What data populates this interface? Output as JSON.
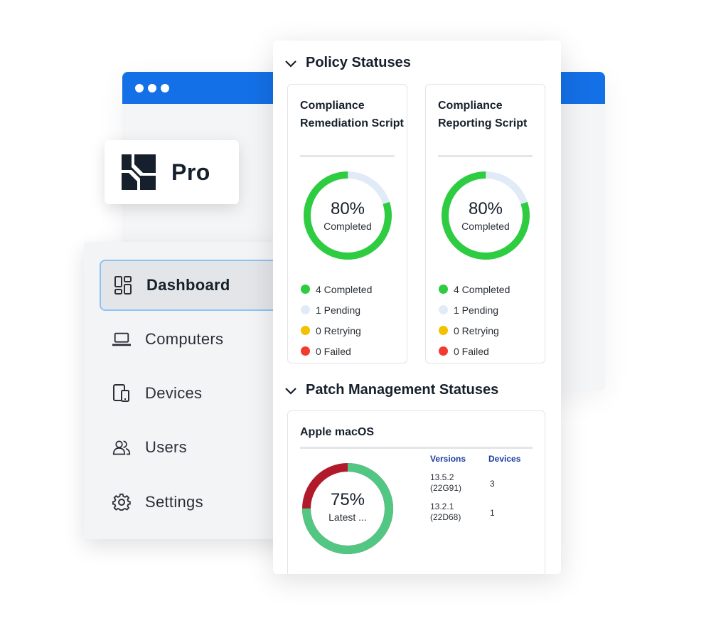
{
  "brand": {
    "name": "Pro"
  },
  "sidebar": {
    "items": [
      {
        "label": "Dashboard",
        "icon": "dashboard-grid-icon",
        "active": true
      },
      {
        "label": "Computers",
        "icon": "laptop-icon",
        "active": false
      },
      {
        "label": "Devices",
        "icon": "devices-icon",
        "active": false
      },
      {
        "label": "Users",
        "icon": "users-icon",
        "active": false
      },
      {
        "label": "Settings",
        "icon": "gear-icon",
        "active": false
      }
    ]
  },
  "policy": {
    "section_title": "Policy Statuses",
    "cards": [
      {
        "title": "Compliance Remediation Script",
        "percent": "80%",
        "percent_label": "Completed",
        "completed_fraction": 0.8,
        "legend": [
          {
            "label": "4 Completed",
            "color": "#2ecc40"
          },
          {
            "label": "1 Pending",
            "color": "#e1ebf8"
          },
          {
            "label": "0 Retrying",
            "color": "#f2c200"
          },
          {
            "label": "0 Failed",
            "color": "#f23a2f"
          }
        ]
      },
      {
        "title": "Compliance Reporting Script",
        "percent": "80%",
        "percent_label": "Completed",
        "completed_fraction": 0.8,
        "legend": [
          {
            "label": "4 Completed",
            "color": "#2ecc40"
          },
          {
            "label": "1 Pending",
            "color": "#e1ebf8"
          },
          {
            "label": "0 Retrying",
            "color": "#f2c200"
          },
          {
            "label": "0 Failed",
            "color": "#f23a2f"
          }
        ]
      }
    ]
  },
  "patch": {
    "section_title": "Patch Management Statuses",
    "card": {
      "title": "Apple macOS",
      "percent": "75%",
      "percent_label": "Latest ...",
      "latest_fraction": 0.75,
      "latest_color": "#52c784",
      "other_color": "#b01a2a",
      "headers": {
        "versions": "Versions",
        "devices": "Devices"
      },
      "rows": [
        {
          "version": "13.5.2",
          "build": "(22G91)",
          "devices": "3"
        },
        {
          "version": "13.2.1",
          "build": "(22D68)",
          "devices": "1"
        }
      ]
    }
  },
  "colors": {
    "accent_blue": "#1470e6",
    "completed_green": "#2ecc40",
    "pending_light": "#e1ebf8"
  }
}
